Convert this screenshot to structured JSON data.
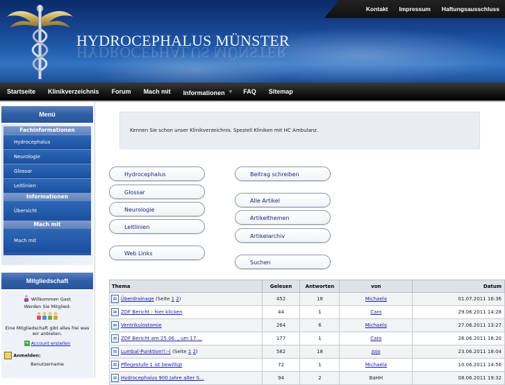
{
  "header": {
    "site_title": "HYDROCEPHALUS MÜNSTER",
    "top_links": [
      "Kontakt",
      "Impressum",
      "Haftungsausschluss"
    ]
  },
  "mainnav": {
    "items": [
      "Startseite",
      "Klinikverzeichnis",
      "Forum",
      "Mach mit",
      "Informationen",
      "FAQ",
      "Sitemap"
    ]
  },
  "sidebar": {
    "menu_title": "Menü",
    "sections": [
      {
        "title": "Fachinformationen",
        "links": [
          "Hydrocephalus",
          "Neurologie",
          "Glossar",
          "Leitlinien"
        ]
      },
      {
        "title": "Informationen",
        "links": [
          "Übersicht"
        ]
      },
      {
        "title": "Mach mit",
        "links": [
          "Mach mit"
        ]
      }
    ],
    "membership": {
      "title": "Mitgliedschaft",
      "welcome": "Willkommen Gast",
      "become_member": "Werden Sie Mitglied:",
      "info": "Eine Mitgliedschaft gibt alles frei was wir anbieten.",
      "create_account": "Account erstellen",
      "login": "Anmelden:",
      "username": "Benutzername"
    }
  },
  "content": {
    "notice": "Kennen Sie schon unser Klinikverzeichnis. Speziell Kliniken mit HC Ambulanz.",
    "left_buttons": [
      "Hydrocephalus",
      "Glossar",
      "Neurologie",
      "Leitlinien",
      "Web Links"
    ],
    "right_buttons": [
      "Beitrag schreiben",
      "Alle Artikel",
      "Artikelthemen",
      "Artikelarchiv",
      "Suchen"
    ]
  },
  "table": {
    "headers": [
      "Thema",
      "Gelesen",
      "Antworten",
      "von",
      "Datum"
    ],
    "rows": [
      {
        "title": "Überdrainage",
        "pages_prefix": "(Seite",
        "pages": [
          "1",
          "2"
        ],
        "pages_suffix": ")",
        "read": "452",
        "answers": "18",
        "by": "Michaela",
        "date": "01.07.2011 16:36"
      },
      {
        "title": "ZDF Bericht - hier klicken",
        "read": "44",
        "answers": "1",
        "by": "Caro",
        "date": "29.06.2011 14:28"
      },
      {
        "title": "Ventrikulostomie",
        "read": "264",
        "answers": "6",
        "by": "Michaela",
        "date": "27.06.2011 13:27"
      },
      {
        "title": "ZDF Bericht am 25.06. , um 17....",
        "read": "177",
        "answers": "1",
        "by": "Caro",
        "date": "26.06.2011 16:20"
      },
      {
        "title": "Lumbal-Punktion!!:-(",
        "pages_prefix": "(Seite",
        "pages": [
          "1",
          "2"
        ],
        "pages_suffix": ")",
        "read": "582",
        "answers": "18",
        "by": "Jojo",
        "date": "23.06.2011 18:04"
      },
      {
        "title": "Pflegestufe 1 ist bewilligt",
        "read": "72",
        "answers": "1",
        "by": "Michaela",
        "date": "10.06.2011 14:56"
      },
      {
        "title": "Hydrocephalus 900 Jahre alter S...",
        "read": "94",
        "answers": "2",
        "by": "BaHH",
        "date": "08.06.2011 19:32"
      }
    ]
  }
}
